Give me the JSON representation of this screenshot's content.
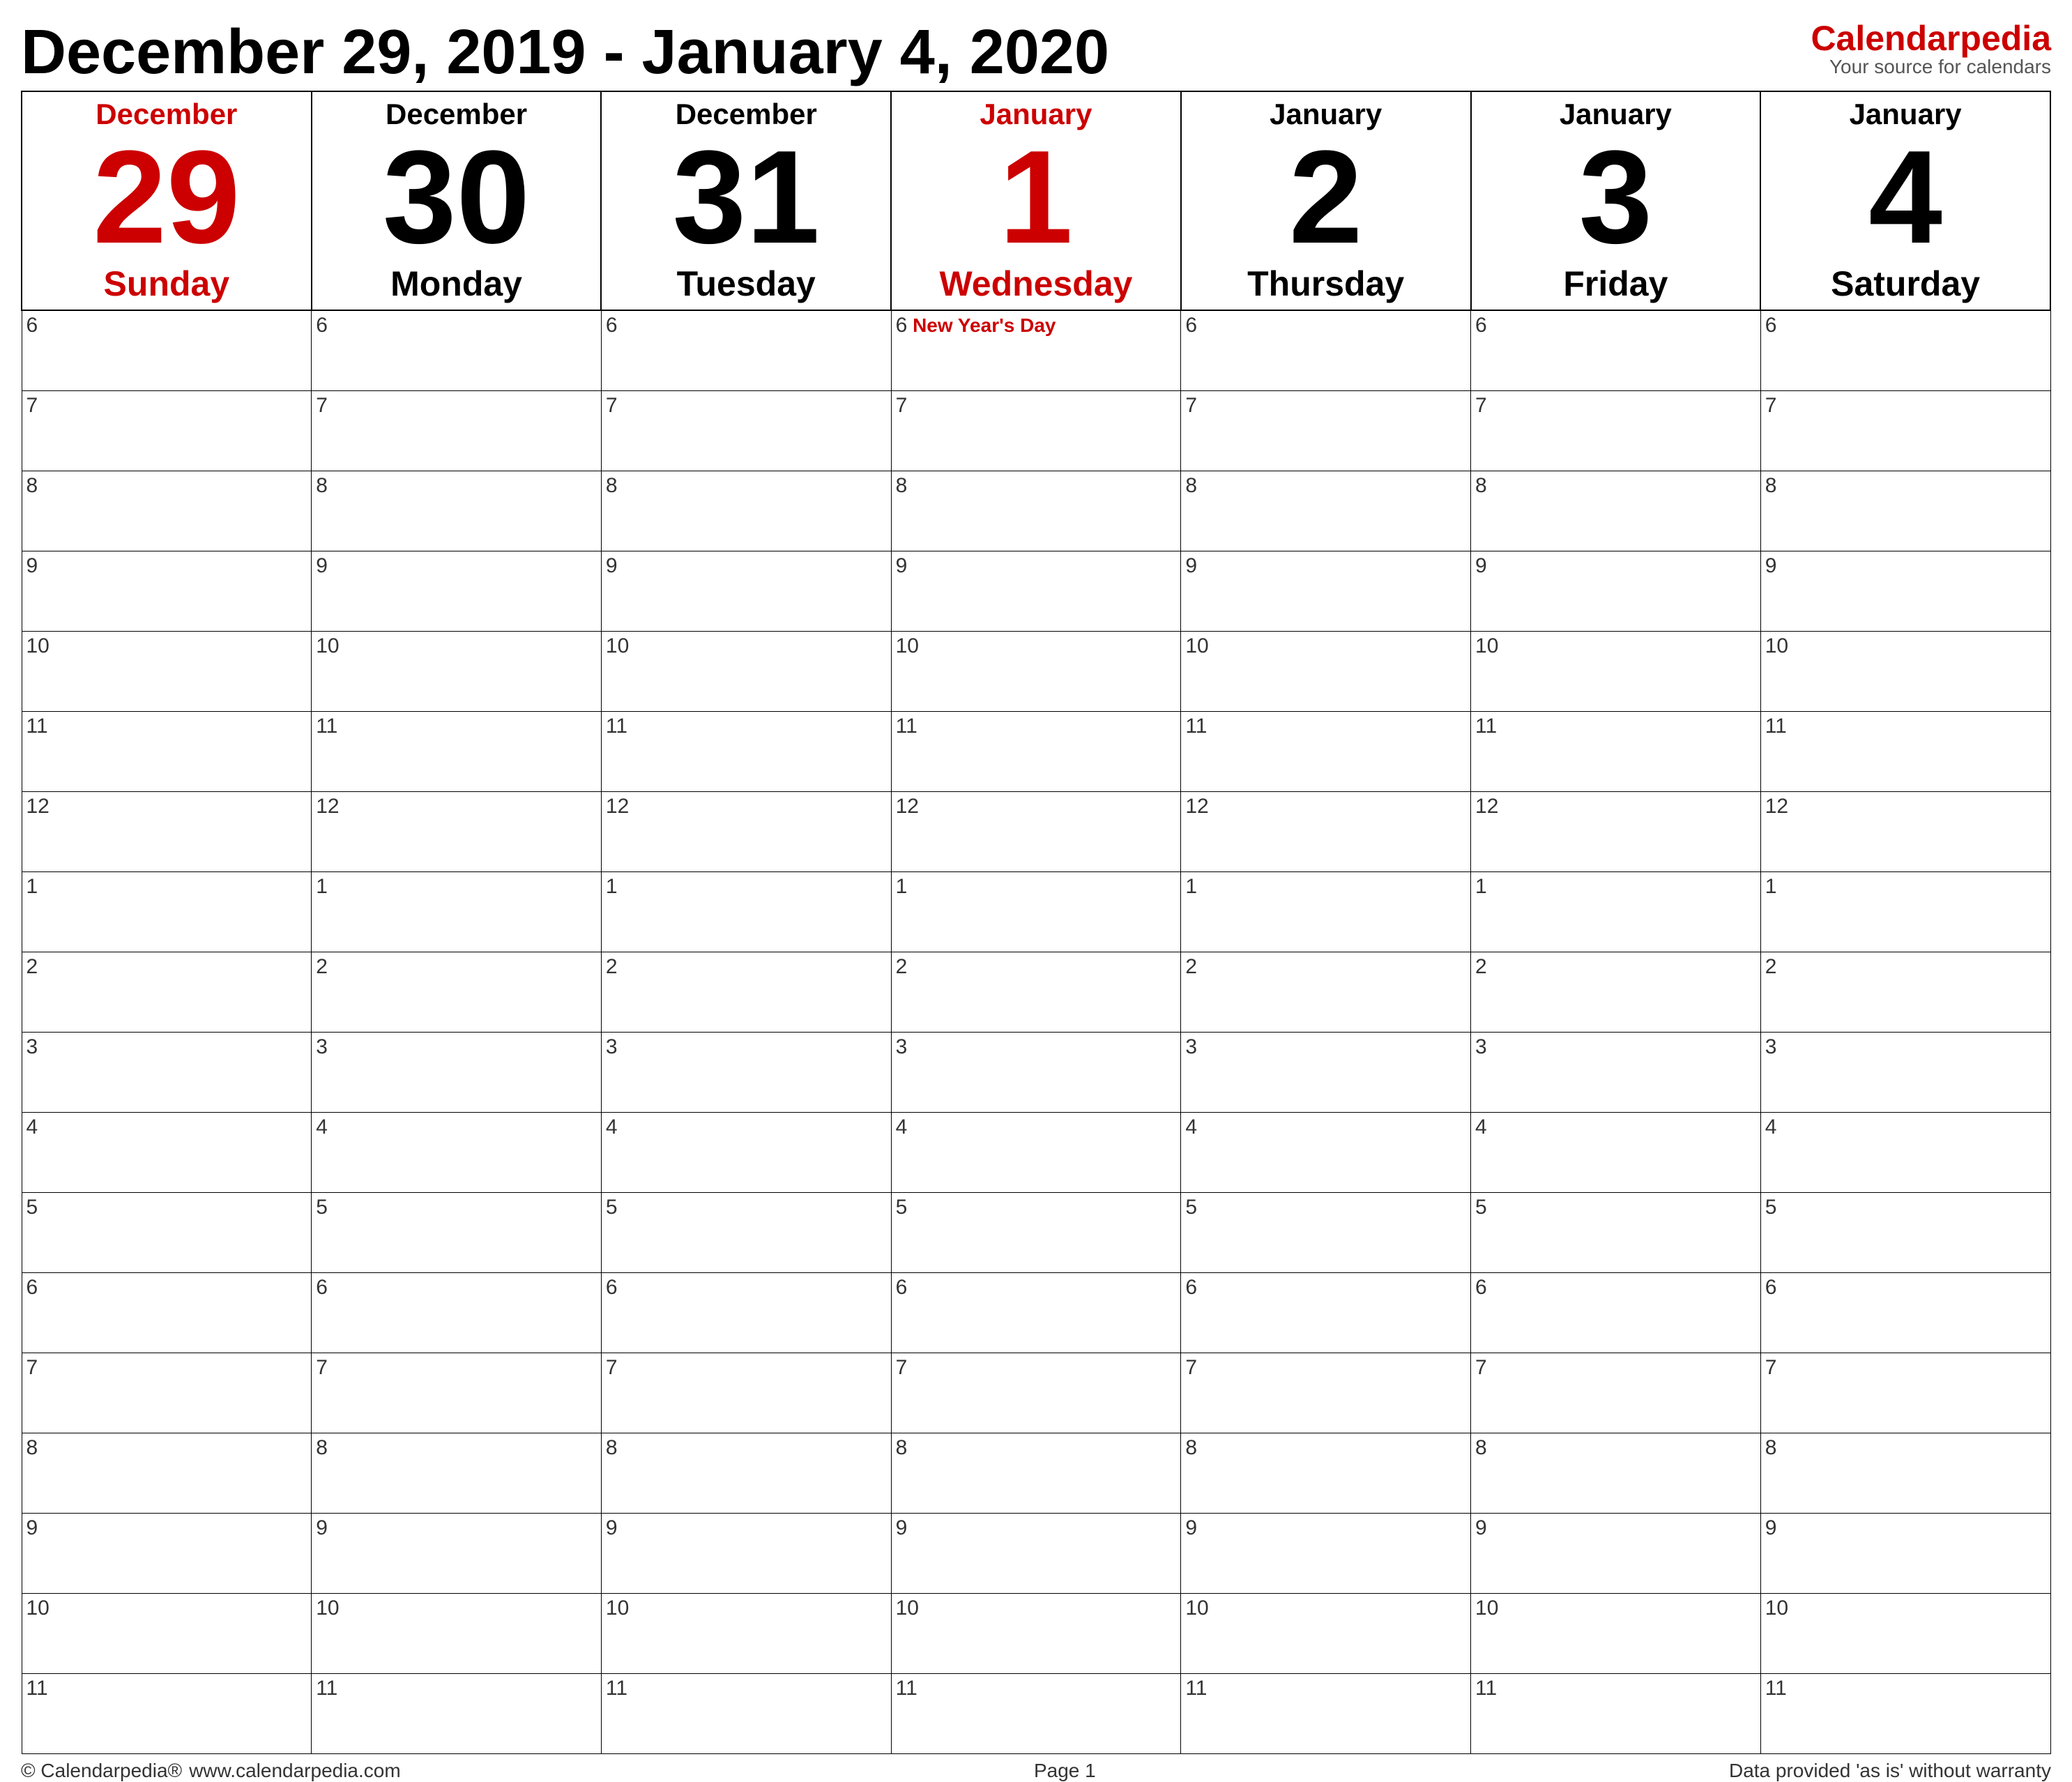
{
  "header": {
    "title": "December 29, 2019 - January 4, 2020",
    "logo_text_1": "Calendar",
    "logo_text_2": "pedia",
    "logo_subtitle": "Your source for calendars"
  },
  "days": [
    {
      "month": "December",
      "month_color": "red",
      "number": "29",
      "number_color": "red",
      "name": "Sunday",
      "name_color": "red",
      "is_today": false,
      "holiday": null
    },
    {
      "month": "December",
      "month_color": "black",
      "number": "30",
      "number_color": "black",
      "name": "Monday",
      "name_color": "black",
      "is_today": false,
      "holiday": null
    },
    {
      "month": "December",
      "month_color": "black",
      "number": "31",
      "number_color": "black",
      "name": "Tuesday",
      "name_color": "black",
      "is_today": false,
      "holiday": null
    },
    {
      "month": "January",
      "month_color": "red",
      "number": "1",
      "number_color": "red",
      "name": "Wednesday",
      "name_color": "red",
      "is_today": true,
      "holiday": "New Year's Day"
    },
    {
      "month": "January",
      "month_color": "black",
      "number": "2",
      "number_color": "black",
      "name": "Thursday",
      "name_color": "black",
      "is_today": false,
      "holiday": null
    },
    {
      "month": "January",
      "month_color": "black",
      "number": "3",
      "number_color": "black",
      "name": "Friday",
      "name_color": "black",
      "is_today": false,
      "holiday": null
    },
    {
      "month": "January",
      "month_color": "black",
      "number": "4",
      "number_color": "black",
      "name": "Saturday",
      "name_color": "black",
      "is_today": false,
      "holiday": null
    }
  ],
  "time_slots_am": [
    "6",
    "7",
    "8",
    "9",
    "10",
    "11",
    "12"
  ],
  "time_slots_pm": [
    "1",
    "2",
    "3",
    "4",
    "5",
    "6",
    "7",
    "8",
    "9",
    "10",
    "11"
  ],
  "footer": {
    "copyright": "© Calendarpedia®",
    "website": "www.calendarpedia.com",
    "page": "Page 1",
    "disclaimer": "Data provided 'as is' without warranty"
  }
}
